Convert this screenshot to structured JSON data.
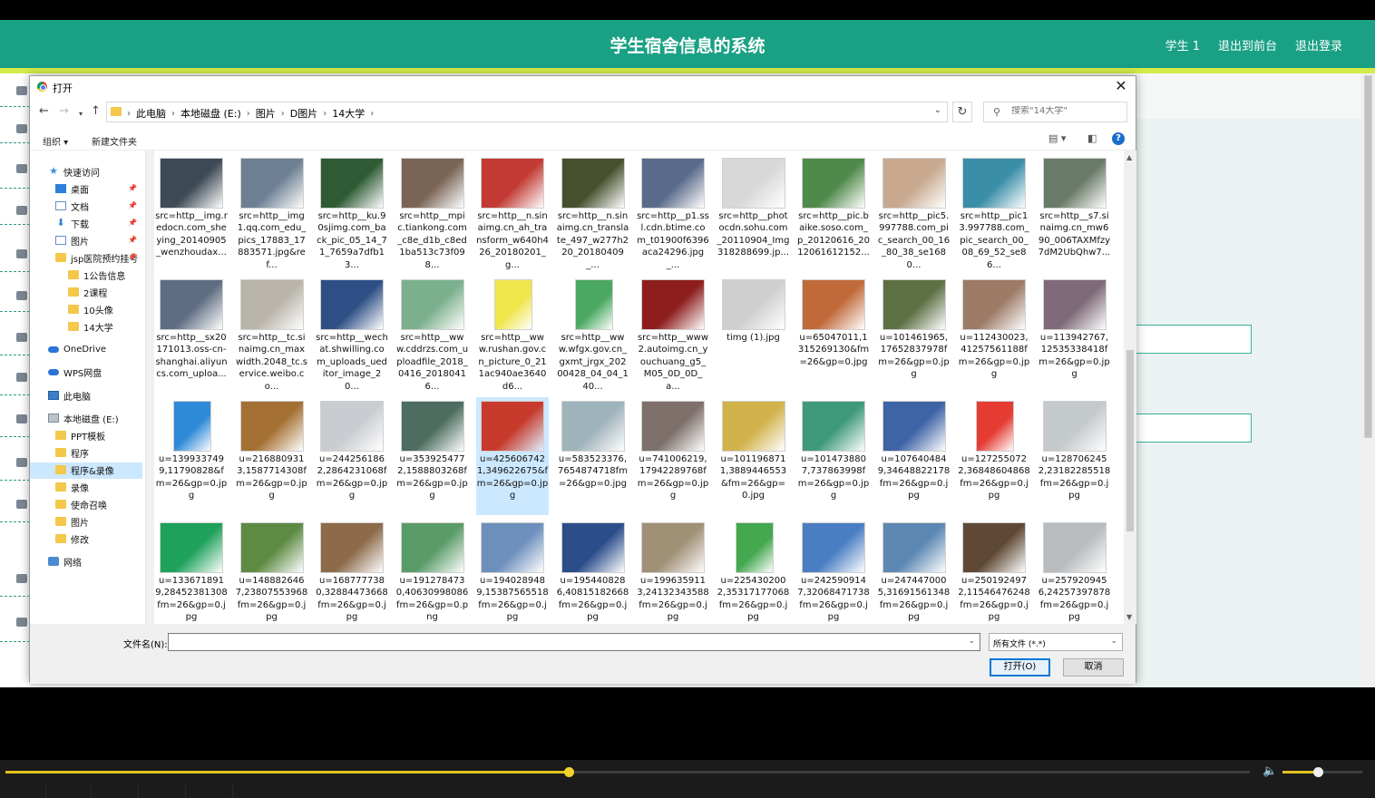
{
  "page": {
    "title": "学生宿舍信息的系统",
    "nav": [
      "学生 1",
      "退出到前台",
      "退出登录"
    ]
  },
  "dialog": {
    "title": "打开",
    "breadcrumbs": [
      "此电脑",
      "本地磁盘 (E:)",
      "图片",
      "D图片",
      "14大学"
    ],
    "search_placeholder": "搜索\"14大学\"",
    "organize": "组织 ▾",
    "new_folder": "新建文件夹",
    "nav_items": [
      {
        "label": "快速访问",
        "icon": "star"
      },
      {
        "label": "桌面",
        "icon": "blue",
        "pin": true
      },
      {
        "label": "文档",
        "icon": "doc",
        "pin": true
      },
      {
        "label": "下载",
        "icon": "down",
        "pin": true
      },
      {
        "label": "图片",
        "icon": "doc",
        "pin": true
      },
      {
        "label": "jsp医院预约挂号",
        "icon": "folder",
        "pin": true
      },
      {
        "label": "1公告信息",
        "icon": "folder"
      },
      {
        "label": "2课程",
        "icon": "folder"
      },
      {
        "label": "10头像",
        "icon": "folder"
      },
      {
        "label": "14大学",
        "icon": "folder"
      },
      {
        "label": "OneDrive",
        "icon": "cloud"
      },
      {
        "label": "WPS网盘",
        "icon": "cloud"
      },
      {
        "label": "此电脑",
        "icon": "pc"
      },
      {
        "label": "本地磁盘 (E:)",
        "icon": "drive"
      },
      {
        "label": "PPT模板",
        "icon": "folder"
      },
      {
        "label": "程序",
        "icon": "folder"
      },
      {
        "label": "程序&录像",
        "icon": "folder"
      },
      {
        "label": "录像",
        "icon": "folder"
      },
      {
        "label": "使命召唤",
        "icon": "folder"
      },
      {
        "label": "图片",
        "icon": "folder"
      },
      {
        "label": "修改",
        "icon": "folder"
      },
      {
        "label": "网络",
        "icon": "net"
      }
    ],
    "files": [
      {
        "name": "src=http__img.redocn.com_sheying_20140905_wenzhoudax...",
        "color": "#3e4a55"
      },
      {
        "name": "src=http__img1.qq.com_edu_pics_17883_17883571.jpg&ref...",
        "color": "#6d7f92"
      },
      {
        "name": "src=http__ku.90sjimg.com_back_pic_05_14_71_7659a7dfb13...",
        "color": "#2f5b34"
      },
      {
        "name": "src=http__mpic.tiankong.com_c8e_d1b_c8ed1ba513c73f098...",
        "color": "#7a6455"
      },
      {
        "name": "src=http__n.sinaimg.cn_ah_transform_w640h426_20180201_g...",
        "color": "#c23a33"
      },
      {
        "name": "src=http__n.sinaimg.cn_translate_497_w277h220_20180409_...",
        "color": "#47502e"
      },
      {
        "name": "src=http__p1.ssl.cdn.btime.com_t01900f6396aca24296.jpg_...",
        "color": "#5a6a8a"
      },
      {
        "name": "src=http__photocdn.sohu.com_20110904_Img318288699.jp...",
        "color": "#d8d8d8"
      },
      {
        "name": "src=http__pic.baike.soso.com_p_20120616_2012061612152...",
        "color": "#4f8a4a"
      },
      {
        "name": "src=http__pic5.997788.com_pic_search_00_16_80_38_se1680...",
        "color": "#c8a98f"
      },
      {
        "name": "src=http__pic13.997788.com_pic_search_00_08_69_52_se86...",
        "color": "#3a8ea8"
      },
      {
        "name": "src=http__s7.sinaimg.cn_mw690_006TAXMfzy7dM2UbQhw7...",
        "color": "#6a7a68"
      },
      {
        "name": "src=http__sx20171013.oss-cn-shanghai.aliyuncs.com_uploa...",
        "color": "#5f6d82"
      },
      {
        "name": "src=http__tc.sinaimg.cn_maxwidth.2048_tc.service.weibo.co...",
        "color": "#b9b4aa"
      },
      {
        "name": "src=http__wechat.shwilling.com_uploads_ueditor_image_20...",
        "color": "#2e4f86"
      },
      {
        "name": "src=http__www.cddrzs.com_uploadfile_2018_0416_20180416...",
        "color": "#7bb08d"
      },
      {
        "name": "src=http__www.rushan.gov.cn_picture_0_211ac940ae3640d6...",
        "color": "#efe64b",
        "tall": true
      },
      {
        "name": "src=http__www.wfgx.gov.cn_gxmt_jrgx_20200428_04_04_140...",
        "color": "#4aa863",
        "tall": true
      },
      {
        "name": "src=http__www2.autoimg.cn_youchuang_g5_M05_0D_0D_a...",
        "color": "#8e1e1e"
      },
      {
        "name": "timg (1).jpg",
        "color": "#cfcfcf"
      },
      {
        "name": "u=65047011,1315269130&fm=26&gp=0.jpg",
        "color": "#c06a3a"
      },
      {
        "name": "u=101461965,17652837978fm=26&gp=0.jpg",
        "color": "#5d7044"
      },
      {
        "name": "u=112430023,41257561188fm=26&gp=0.jpg",
        "color": "#9c7a66"
      },
      {
        "name": "u=113942767,12535338418fm=26&gp=0.jpg",
        "color": "#7e6a78"
      },
      {
        "name": "u=1399337499,11790828&fm=26&gp=0.jpg",
        "color": "#2f8ad8",
        "tall": true
      },
      {
        "name": "u=2168809313,1587714308fm=26&gp=0.jpg",
        "color": "#a57033"
      },
      {
        "name": "u=2442561862,2864231068fm=26&gp=0.jpg",
        "color": "#c9cdd1"
      },
      {
        "name": "u=3539254772,1588803268fm=26&gp=0.jpg",
        "color": "#4c6d5f"
      },
      {
        "name": "u=4256067421,349622675&fm=26&gp=0.jpg",
        "color": "#c83a2c",
        "selected": true
      },
      {
        "name": "u=583523376,7654874718fm=26&gp=0.jpg",
        "color": "#9fb3bb"
      },
      {
        "name": "u=741006219,17942289768fm=26&gp=0.jpg",
        "color": "#7d6f6a"
      },
      {
        "name": "u=1011968711,3889446553&fm=26&gp=0.jpg",
        "color": "#d2b24a"
      },
      {
        "name": "u=1014738807,737863998fm=26&gp=0.jpg",
        "color": "#3f9a7c"
      },
      {
        "name": "u=1076404849,34648822178fm=26&gp=0.jpg",
        "color": "#3e64a6"
      },
      {
        "name": "u=1272550722,36848604868fm=26&gp=0.jpg",
        "color": "#e53b32",
        "tall": true
      },
      {
        "name": "u=1287062452,23182285518fm=26&gp=0.jpg",
        "color": "#c4c9cc"
      },
      {
        "name": "u=1336718919,28452381308fm=26&gp=0.jpg",
        "color": "#1ea15b"
      },
      {
        "name": "u=1488826467,23807553968fm=26&gp=0.jpg",
        "color": "#5d8b43"
      },
      {
        "name": "u=1687777380,32884473668fm=26&gp=0.jpg",
        "color": "#8c6a4a"
      },
      {
        "name": "u=1912784730,40630998086fm=26&gp=0.png",
        "color": "#5a9c68"
      },
      {
        "name": "u=1940289489,15387565518fm=26&gp=0.jpg",
        "color": "#6c8fbc"
      },
      {
        "name": "u=1954408286,40815182668fm=26&gp=0.jpg",
        "color": "#2b4d8a"
      },
      {
        "name": "u=1996359113,24132343588fm=26&gp=0.jpg",
        "color": "#a09076"
      },
      {
        "name": "u=2254302002,35317177068fm=26&gp=0.jpg",
        "color": "#43a84e",
        "tall": true
      },
      {
        "name": "u=2425909147,32068471738fm=26&gp=0.jpg",
        "color": "#4a7ec2"
      },
      {
        "name": "u=2474470005,31691561348fm=26&gp=0.jpg",
        "color": "#5e88b4"
      },
      {
        "name": "u=2501924972,11546476248fm=26&gp=0.jpg",
        "color": "#5f4936"
      },
      {
        "name": "u=2579209456,24257397878fm=26&gp=0.jpg",
        "color": "#b8bcbf"
      }
    ],
    "filename_label": "文件名(N):",
    "filename_value": "",
    "filetype": "所有文件 (*.*)",
    "open_label": "打开(O)",
    "cancel_label": "取消"
  },
  "player": {
    "progress": 0.453,
    "volume": 0.45
  },
  "colors": {
    "brand": "#1aa085",
    "accent_line": "#d4ec4a",
    "selection": "#cce8ff",
    "progress": "#e2c21d"
  }
}
